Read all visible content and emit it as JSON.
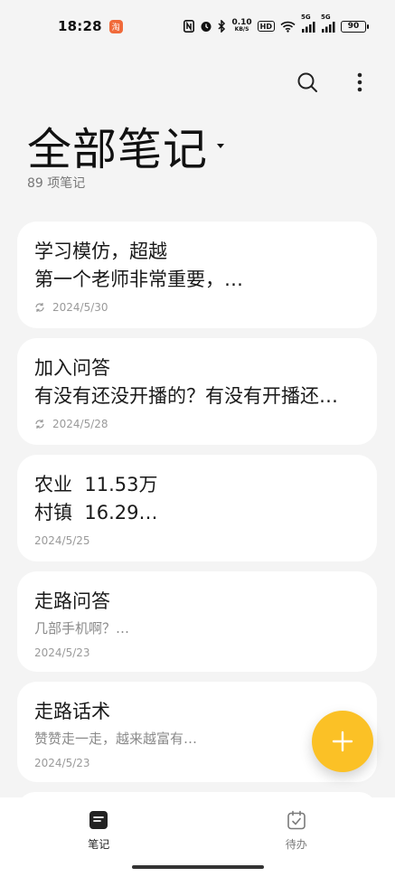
{
  "status_bar": {
    "time": "18:28",
    "app_badge_label": "淘",
    "speed_value": "0.10",
    "speed_unit": "KB/S",
    "hd_label": "HD",
    "sim1_label": "5G",
    "sim2_label": "5G",
    "battery": "90"
  },
  "header": {
    "title": "全部笔记",
    "count": "89 项笔记"
  },
  "notes": [
    {
      "title": "学习模仿，超越",
      "body": "第一个老师非常重要，…",
      "body_style": "large",
      "date": "2024/5/30",
      "synced": true
    },
    {
      "title": "加入问答",
      "body": "有没有还没开播的？有没有开播还…",
      "body_style": "large",
      "date": "2024/5/28",
      "synced": true
    },
    {
      "title": "农业  11.53万",
      "body": "村镇  16.29…",
      "body_style": "large",
      "date": "2024/5/25",
      "synced": false
    },
    {
      "title": "走路问答",
      "body": "几部手机啊？…",
      "body_style": "small",
      "date": "2024/5/23",
      "synced": false
    },
    {
      "title": "走路话术",
      "body": "赞赞走一走，越来越富有…",
      "body_style": "small",
      "date": "2024/5/23",
      "synced": false
    }
  ],
  "bottom_nav": {
    "notes_label": "笔记",
    "todo_label": "待办"
  },
  "colors": {
    "accent": "#fbc126",
    "background": "#f4f4f4",
    "card": "#ffffff"
  }
}
